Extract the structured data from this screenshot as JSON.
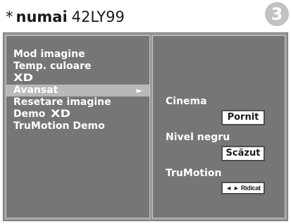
{
  "header": {
    "asterisk": "*",
    "brand": "numai",
    "model": "42LY99",
    "step_number": "3"
  },
  "menu": {
    "items": [
      {
        "label": "Mod imagine"
      },
      {
        "label": "Temp. culoare"
      },
      {
        "label": "XD",
        "logo": true
      },
      {
        "label": "Avansat",
        "selected": true,
        "arrow": "►"
      },
      {
        "label": "Resetare imagine"
      },
      {
        "label": "Demo",
        "logo_suffix": "XD"
      },
      {
        "label": "TruMotion Demo"
      }
    ]
  },
  "settings": {
    "cinema": {
      "label": "Cinema",
      "value": "Pornit"
    },
    "nivel_negru": {
      "label": "Nivel negru",
      "value": "Scăzut"
    },
    "trumotion": {
      "label": "TruMotion",
      "value": "◄ ► Ridicat"
    }
  }
}
